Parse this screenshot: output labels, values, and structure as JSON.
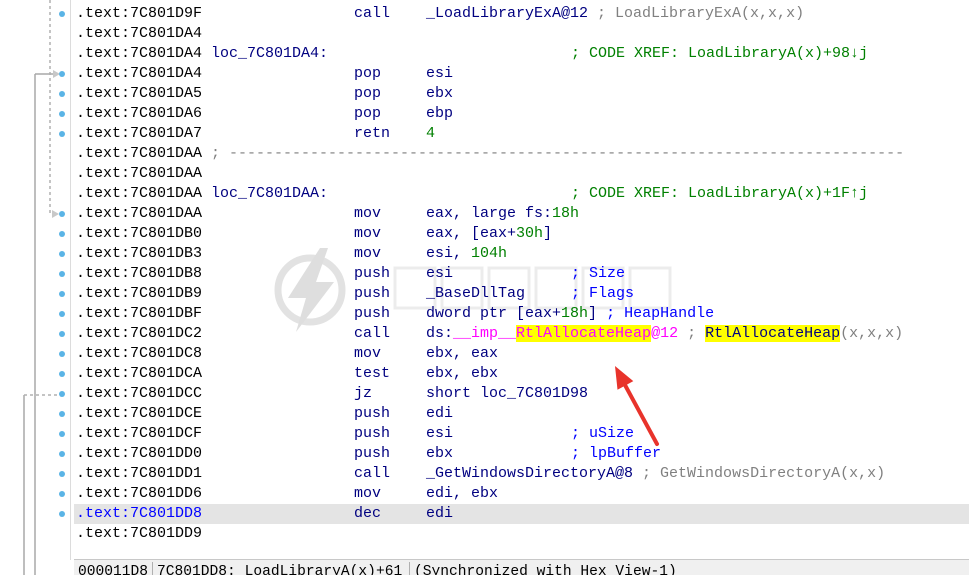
{
  "lines": [
    {
      "addr": ".text:7C801D9F",
      "dot": true,
      "mnem": "call",
      "ops": [
        {
          "t": "_LoadLibraryExA@12",
          "k": "name"
        },
        {
          "t": " ; LoadLibraryExA(x,x,x)",
          "k": "auto"
        }
      ]
    },
    {
      "addr": ".text:7C801DA4"
    },
    {
      "addr": ".text:7C801DA4",
      "label": "loc_7C801DA4:",
      "xref": "; CODE XREF: LoadLibraryA(x)+98↓j"
    },
    {
      "addr": ".text:7C801DA4",
      "dot": true,
      "mnem": "pop",
      "ops": [
        {
          "t": "esi",
          "k": "op"
        }
      ]
    },
    {
      "addr": ".text:7C801DA5",
      "dot": true,
      "mnem": "pop",
      "ops": [
        {
          "t": "ebx",
          "k": "op"
        }
      ]
    },
    {
      "addr": ".text:7C801DA6",
      "dot": true,
      "mnem": "pop",
      "ops": [
        {
          "t": "ebp",
          "k": "op"
        }
      ]
    },
    {
      "addr": ".text:7C801DA7",
      "dot": true,
      "mnem": "retn",
      "ops": [
        {
          "t": "4",
          "k": "num"
        }
      ]
    },
    {
      "addr": ".text:7C801DAA",
      "sep": "; ---------------------------------------------------------------------------"
    },
    {
      "addr": ".text:7C801DAA"
    },
    {
      "addr": ".text:7C801DAA",
      "label": "loc_7C801DAA:",
      "xref": "; CODE XREF: LoadLibraryA(x)+1F↑j"
    },
    {
      "addr": ".text:7C801DAA",
      "dot": true,
      "mnem": "mov",
      "ops": [
        {
          "t": "eax, large fs:",
          "k": "op"
        },
        {
          "t": "18h",
          "k": "num"
        }
      ]
    },
    {
      "addr": ".text:7C801DB0",
      "dot": true,
      "mnem": "mov",
      "ops": [
        {
          "t": "eax, [eax+",
          "k": "op"
        },
        {
          "t": "30h",
          "k": "num"
        },
        {
          "t": "]",
          "k": "op"
        }
      ]
    },
    {
      "addr": ".text:7C801DB3",
      "dot": true,
      "mnem": "mov",
      "ops": [
        {
          "t": "esi, ",
          "k": "op"
        },
        {
          "t": "104h",
          "k": "num"
        }
      ]
    },
    {
      "addr": ".text:7C801DB8",
      "dot": true,
      "mnem": "push",
      "ops": [
        {
          "t": "esi",
          "k": "op"
        }
      ],
      "colcmt": "; Size"
    },
    {
      "addr": ".text:7C801DB9",
      "dot": true,
      "mnem": "push",
      "ops": [
        {
          "t": "_BaseDllTag",
          "k": "name"
        }
      ],
      "colcmt": "; Flags"
    },
    {
      "addr": ".text:7C801DBF",
      "dot": true,
      "mnem": "push",
      "ops": [
        {
          "t": "dword ptr [eax+",
          "k": "op"
        },
        {
          "t": "18h",
          "k": "num"
        },
        {
          "t": "]",
          "k": "op"
        },
        {
          "t": " ; HeapHandle",
          "k": "var"
        }
      ]
    },
    {
      "addr": ".text:7C801DC2",
      "dot": true,
      "mnem": "call",
      "ops": [
        {
          "t": "ds:",
          "k": "op"
        },
        {
          "t": "__imp__",
          "k": "imp"
        },
        {
          "t": "RtlAllocateHeap",
          "k": "imp-hl"
        },
        {
          "t": "@12",
          "k": "imp"
        },
        {
          "t": " ; ",
          "k": "auto"
        },
        {
          "t": "RtlAllocateHeap",
          "k": "hl"
        },
        {
          "t": "(x,x,x)",
          "k": "auto"
        }
      ]
    },
    {
      "addr": ".text:7C801DC8",
      "dot": true,
      "mnem": "mov",
      "ops": [
        {
          "t": "ebx, eax",
          "k": "op"
        }
      ]
    },
    {
      "addr": ".text:7C801DCA",
      "dot": true,
      "mnem": "test",
      "ops": [
        {
          "t": "ebx, ebx",
          "k": "op"
        }
      ]
    },
    {
      "addr": ".text:7C801DCC",
      "dot": true,
      "mnem": "jz",
      "ops": [
        {
          "t": "short loc_7C801D98",
          "k": "op"
        }
      ]
    },
    {
      "addr": ".text:7C801DCE",
      "dot": true,
      "mnem": "push",
      "ops": [
        {
          "t": "edi",
          "k": "op"
        }
      ]
    },
    {
      "addr": ".text:7C801DCF",
      "dot": true,
      "mnem": "push",
      "ops": [
        {
          "t": "esi",
          "k": "op"
        }
      ],
      "colcmt": "; uSize"
    },
    {
      "addr": ".text:7C801DD0",
      "dot": true,
      "mnem": "push",
      "ops": [
        {
          "t": "ebx",
          "k": "op"
        }
      ],
      "colcmt": "; lpBuffer"
    },
    {
      "addr": ".text:7C801DD1",
      "dot": true,
      "mnem": "call",
      "ops": [
        {
          "t": "_GetWindowsDirectoryA@8",
          "k": "name"
        },
        {
          "t": " ; GetWindowsDirectoryA(x,x)",
          "k": "auto"
        }
      ]
    },
    {
      "addr": ".text:7C801DD6",
      "dot": true,
      "mnem": "mov",
      "ops": [
        {
          "t": "edi, ebx",
          "k": "op"
        }
      ]
    },
    {
      "addr": ".text:7C801DD8",
      "dot": true,
      "sel": true,
      "mnem": "dec",
      "ops": [
        {
          "t": "edi",
          "k": "op"
        }
      ]
    },
    {
      "addr": ".text:7C801DD9"
    }
  ],
  "status_bar": {
    "offset": "000011D8",
    "location": "7C801DD8: LoadLibraryA(x)+61",
    "sync": "(Synchronized with Hex View-1)"
  },
  "watermark": {
    "text": "奇安信攻防社区",
    "icon": "lightning-logo-icon"
  },
  "colors": {
    "address": "#000000",
    "selected_address": "#0000ff",
    "mnemonic": "#000080",
    "number": "#008000",
    "import": "#ff00ff",
    "highlight": "#ffff00",
    "auto_comment": "#808080",
    "var_comment": "#0000ff",
    "xref": "#008000",
    "selection_row": "#e4e4e4",
    "annotation_arrow": "#e8332b"
  }
}
